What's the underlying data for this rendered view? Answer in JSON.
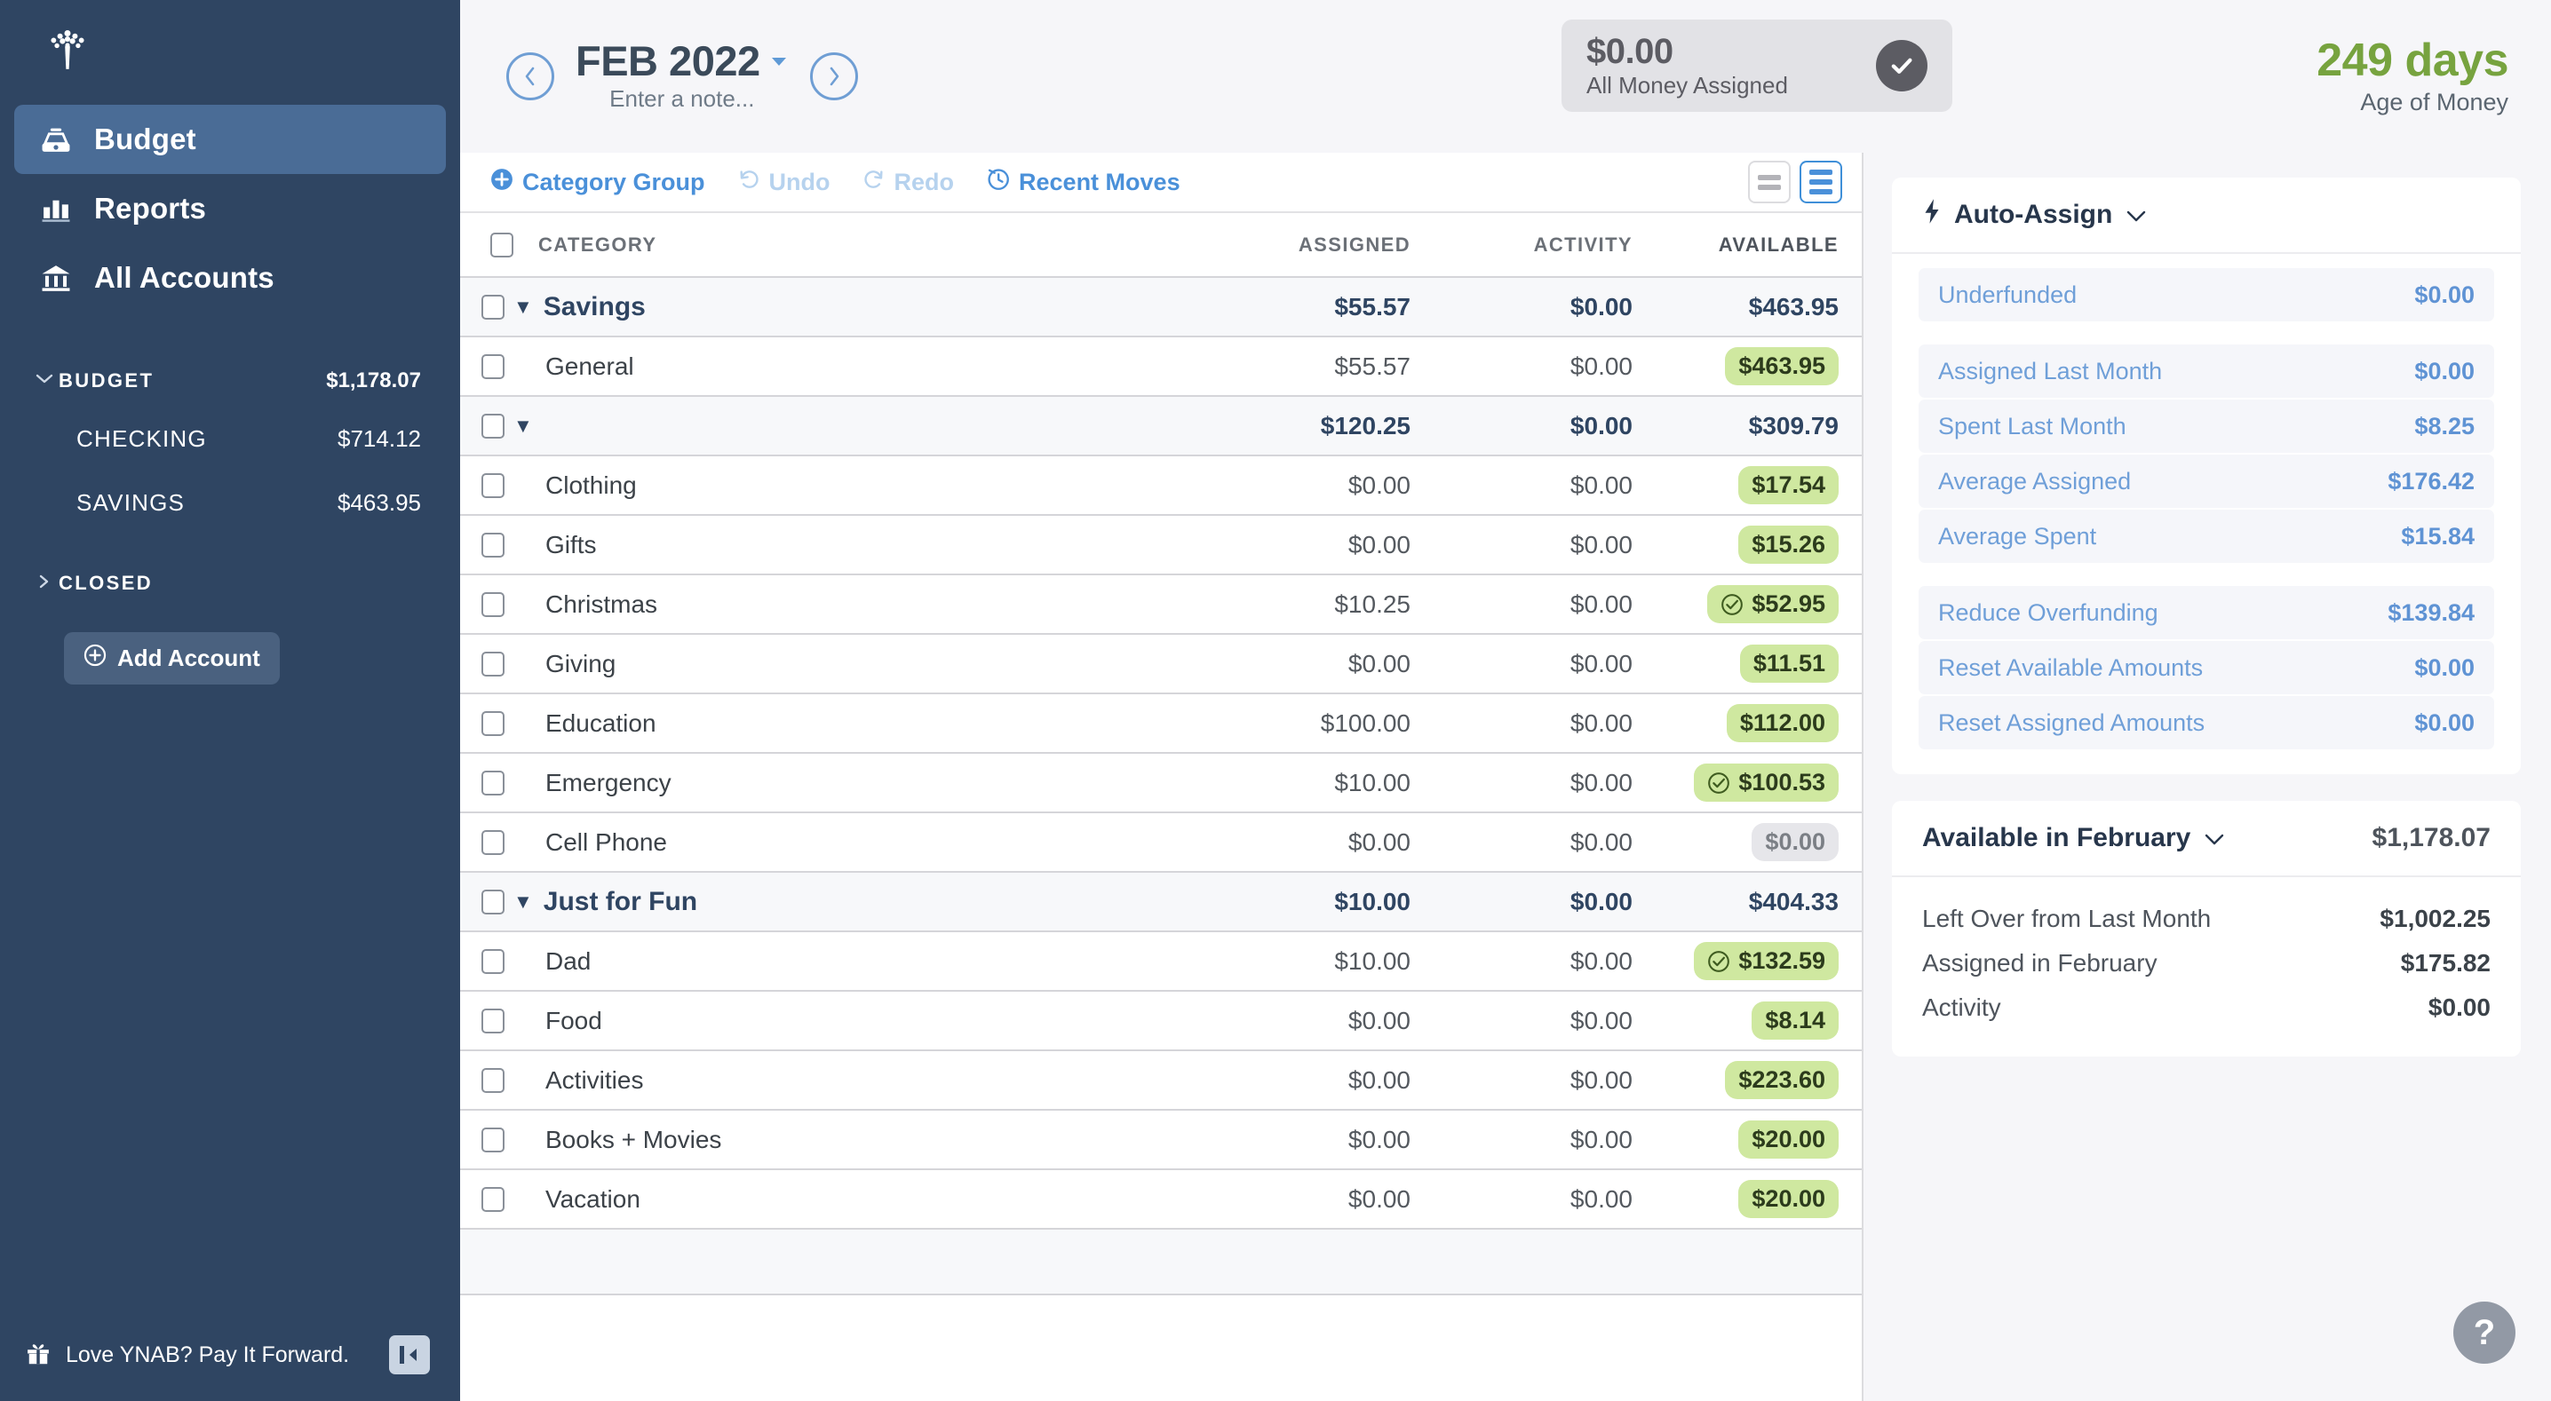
{
  "sidebar": {
    "logo_icon": "ynab-tree-logo",
    "nav": [
      {
        "label": "Budget",
        "icon": "budget-icon",
        "active": true
      },
      {
        "label": "Reports",
        "icon": "bar-chart-icon",
        "active": false
      },
      {
        "label": "All Accounts",
        "icon": "bank-icon",
        "active": false
      }
    ],
    "budget_group": {
      "label": "BUDGET",
      "amount": "$1,178.07",
      "caret": "chevron-down-icon"
    },
    "accounts": [
      {
        "name": "CHECKING",
        "amount": "$714.12"
      },
      {
        "name": "SAVINGS",
        "amount": "$463.95"
      }
    ],
    "closed_group": {
      "label": "CLOSED",
      "caret": "chevron-right-icon"
    },
    "add_account": {
      "label": "Add Account",
      "icon": "plus-circle-icon"
    },
    "footer": {
      "label": "Love YNAB? Pay It Forward.",
      "icon": "gift-icon",
      "collapse_icon": "collapse-sidebar-icon"
    }
  },
  "header": {
    "prev_icon": "chevron-left-circle-icon",
    "next_icon": "chevron-right-circle-icon",
    "month": "FEB 2022",
    "month_caret": "caret-down-icon",
    "note_placeholder": "Enter a note...",
    "to_assign": {
      "amount": "$0.00",
      "status": "All Money Assigned",
      "icon": "check-circle-icon"
    },
    "age_of_money": {
      "value": "249 days",
      "label": "Age of Money",
      "color": "#77a33f"
    }
  },
  "toolbar": {
    "category_group": {
      "label": "Category Group",
      "icon": "plus-circle-icon",
      "disabled": false
    },
    "undo": {
      "label": "Undo",
      "icon": "undo-icon",
      "disabled": true
    },
    "redo": {
      "label": "Redo",
      "icon": "redo-icon",
      "disabled": true
    },
    "recent_moves": {
      "label": "Recent Moves",
      "icon": "clock-icon",
      "disabled": false
    },
    "view_compact": {
      "icon": "view-compact-icon",
      "active": false
    },
    "view_detailed": {
      "icon": "view-detailed-icon",
      "active": true
    }
  },
  "table": {
    "columns": [
      "CATEGORY",
      "ASSIGNED",
      "ACTIVITY",
      "AVAILABLE"
    ],
    "rows": [
      {
        "type": "group",
        "name": "Savings",
        "assigned": "$55.57",
        "activity": "$0.00",
        "available": "$463.95"
      },
      {
        "type": "category",
        "name": "General",
        "assigned": "$55.57",
        "activity": "$0.00",
        "available": "$463.95",
        "pill": "green",
        "goal_met": false
      },
      {
        "type": "group",
        "name": "",
        "assigned": "$120.25",
        "activity": "$0.00",
        "available": "$309.79"
      },
      {
        "type": "category",
        "name": "Clothing",
        "assigned": "$0.00",
        "activity": "$0.00",
        "available": "$17.54",
        "pill": "green",
        "goal_met": false
      },
      {
        "type": "category",
        "name": "Gifts",
        "assigned": "$0.00",
        "activity": "$0.00",
        "available": "$15.26",
        "pill": "green",
        "goal_met": false
      },
      {
        "type": "category",
        "name": "Christmas",
        "assigned": "$10.25",
        "activity": "$0.00",
        "available": "$52.95",
        "pill": "green",
        "goal_met": true
      },
      {
        "type": "category",
        "name": "Giving",
        "assigned": "$0.00",
        "activity": "$0.00",
        "available": "$11.51",
        "pill": "green",
        "goal_met": false
      },
      {
        "type": "category",
        "name": "Education",
        "assigned": "$100.00",
        "activity": "$0.00",
        "available": "$112.00",
        "pill": "green",
        "goal_met": false
      },
      {
        "type": "category",
        "name": "Emergency",
        "assigned": "$10.00",
        "activity": "$0.00",
        "available": "$100.53",
        "pill": "green",
        "goal_met": true
      },
      {
        "type": "category",
        "name": "Cell Phone",
        "assigned": "$0.00",
        "activity": "$0.00",
        "available": "$0.00",
        "pill": "grey",
        "goal_met": false
      },
      {
        "type": "group",
        "name": "Just for Fun",
        "assigned": "$10.00",
        "activity": "$0.00",
        "available": "$404.33"
      },
      {
        "type": "category",
        "name": "Dad",
        "assigned": "$10.00",
        "activity": "$0.00",
        "available": "$132.59",
        "pill": "green",
        "goal_met": true
      },
      {
        "type": "category",
        "name": "Food",
        "assigned": "$0.00",
        "activity": "$0.00",
        "available": "$8.14",
        "pill": "green",
        "goal_met": false
      },
      {
        "type": "category",
        "name": "Activities",
        "assigned": "$0.00",
        "activity": "$0.00",
        "available": "$223.60",
        "pill": "green",
        "goal_met": false
      },
      {
        "type": "category",
        "name": "Books + Movies",
        "assigned": "$0.00",
        "activity": "$0.00",
        "available": "$20.00",
        "pill": "green",
        "goal_met": false
      },
      {
        "type": "category",
        "name": "Vacation",
        "assigned": "$0.00",
        "activity": "$0.00",
        "available": "$20.00",
        "pill": "green",
        "goal_met": false
      }
    ]
  },
  "inspector": {
    "auto_assign": {
      "title": "Auto-Assign",
      "icon": "lightning-bolt-icon",
      "chevron": "chevron-down-icon",
      "groups": [
        [
          {
            "label": "Underfunded",
            "amount": "$0.00"
          }
        ],
        [
          {
            "label": "Assigned Last Month",
            "amount": "$0.00"
          },
          {
            "label": "Spent Last Month",
            "amount": "$8.25"
          },
          {
            "label": "Average Assigned",
            "amount": "$176.42"
          },
          {
            "label": "Average Spent",
            "amount": "$15.84"
          }
        ],
        [
          {
            "label": "Reduce Overfunding",
            "amount": "$139.84"
          },
          {
            "label": "Reset Available Amounts",
            "amount": "$0.00"
          },
          {
            "label": "Reset Assigned Amounts",
            "amount": "$0.00"
          }
        ]
      ]
    },
    "available": {
      "title": "Available in February",
      "chevron": "chevron-down-icon",
      "total": "$1,178.07",
      "rows": [
        {
          "label": "Left Over from Last Month",
          "amount": "$1,002.25"
        },
        {
          "label": "Assigned in February",
          "amount": "$175.82"
        },
        {
          "label": "Activity",
          "amount": "$0.00"
        }
      ]
    },
    "help": {
      "label": "?",
      "icon": "help-icon"
    }
  }
}
